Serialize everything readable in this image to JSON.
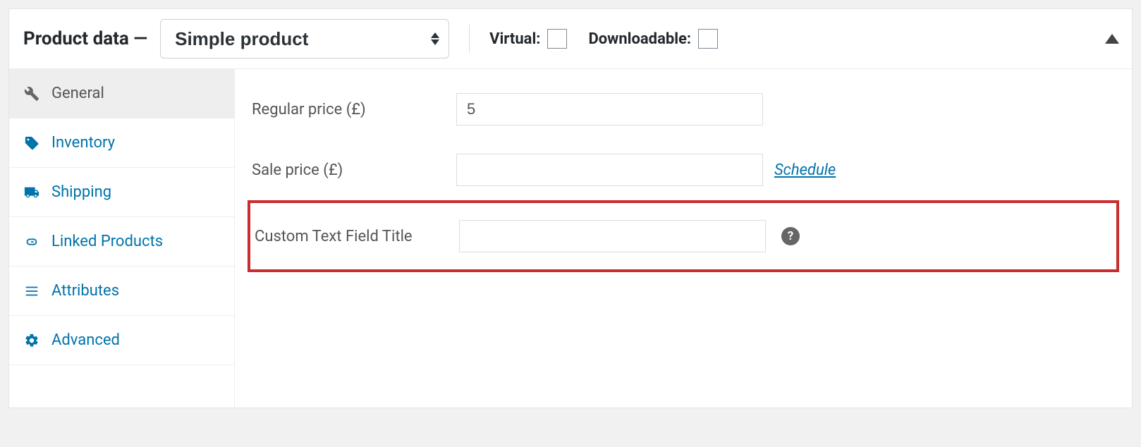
{
  "header": {
    "title_prefix": "Product data —",
    "product_type": "Simple product",
    "virtual_label": "Virtual:",
    "downloadable_label": "Downloadable:"
  },
  "sidebar": {
    "items": [
      {
        "label": "General"
      },
      {
        "label": "Inventory"
      },
      {
        "label": "Shipping"
      },
      {
        "label": "Linked Products"
      },
      {
        "label": "Attributes"
      },
      {
        "label": "Advanced"
      }
    ]
  },
  "general": {
    "regular_price_label": "Regular price (£)",
    "regular_price_value": "5",
    "sale_price_label": "Sale price (£)",
    "sale_price_value": "",
    "schedule_link": "Schedule",
    "custom_field_label": "Custom Text Field Title",
    "custom_field_value": "",
    "help_glyph": "?"
  }
}
